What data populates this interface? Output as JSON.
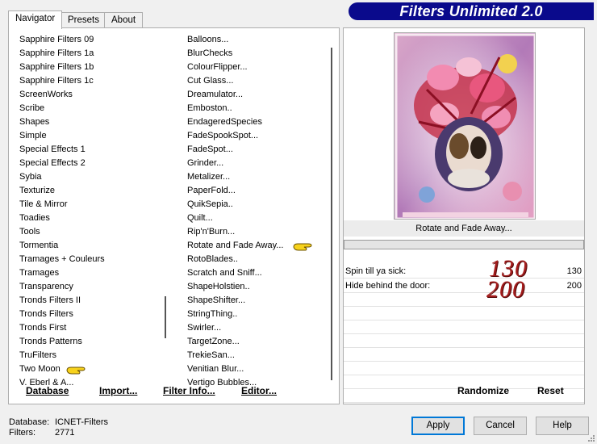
{
  "tabs": [
    "Navigator",
    "Presets",
    "About"
  ],
  "title": "Filters Unlimited 2.0",
  "categories": [
    "Sapphire Filters 09",
    "Sapphire Filters 1a",
    "Sapphire Filters 1b",
    "Sapphire Filters 1c",
    "ScreenWorks",
    "Scribe",
    "Shapes",
    "Simple",
    "Special Effects 1",
    "Special Effects 2",
    "Sybia",
    "Texturize",
    "Tile & Mirror",
    "Toadies",
    "Tools",
    "Tormentia",
    "Tramages + Couleurs",
    "Tramages",
    "Transparency",
    "Tronds Filters II",
    "Tronds Filters",
    "Tronds First",
    "Tronds Patterns",
    "TruFilters",
    "Two Moon",
    "V. Eberl & A..."
  ],
  "filters": [
    "Balloons...",
    "BlurChecks",
    "ColourFlipper...",
    "Cut Glass...",
    "Dreamulator...",
    "Emboston..",
    "EndageredSpecies",
    "FadeSpookSpot...",
    "FadeSpot...",
    "Grinder...",
    "Metalizer...",
    "PaperFold...",
    "QuikSepia..",
    "Quilt...",
    "Rip'n'Burn...",
    "Rotate and Fade Away...",
    "RotoBlades..",
    "Scratch and Sniff...",
    "ShapeHolstien..",
    "ShapeShifter...",
    "StringThing..",
    "Swirler...",
    "TargetZone...",
    "TrekieSan...",
    "Venitian Blur...",
    "Vertigo Bubbles..."
  ],
  "left_buttons": {
    "database": "Database",
    "import": "Import...",
    "filter_info": "Filter Info...",
    "editor": "Editor..."
  },
  "selected_filter": "Rotate and Fade Away...",
  "params": [
    {
      "label": "Spin till ya sick:",
      "value": "130"
    },
    {
      "label": "Hide behind the door:",
      "value": "200"
    }
  ],
  "overlay": {
    "v1": "130",
    "v2": "200"
  },
  "right_buttons": {
    "randomize": "Randomize",
    "reset": "Reset"
  },
  "status": {
    "db_label": "Database:",
    "db_value": "ICNET-Filters",
    "filters_label": "Filters:",
    "filters_value": "2771"
  },
  "dialog_buttons": {
    "apply": "Apply",
    "cancel": "Cancel",
    "help": "Help"
  },
  "colors": {
    "title_bg": "#0a0a8c",
    "overlay_text": "#a41c1c",
    "accent": "#0078d7"
  }
}
